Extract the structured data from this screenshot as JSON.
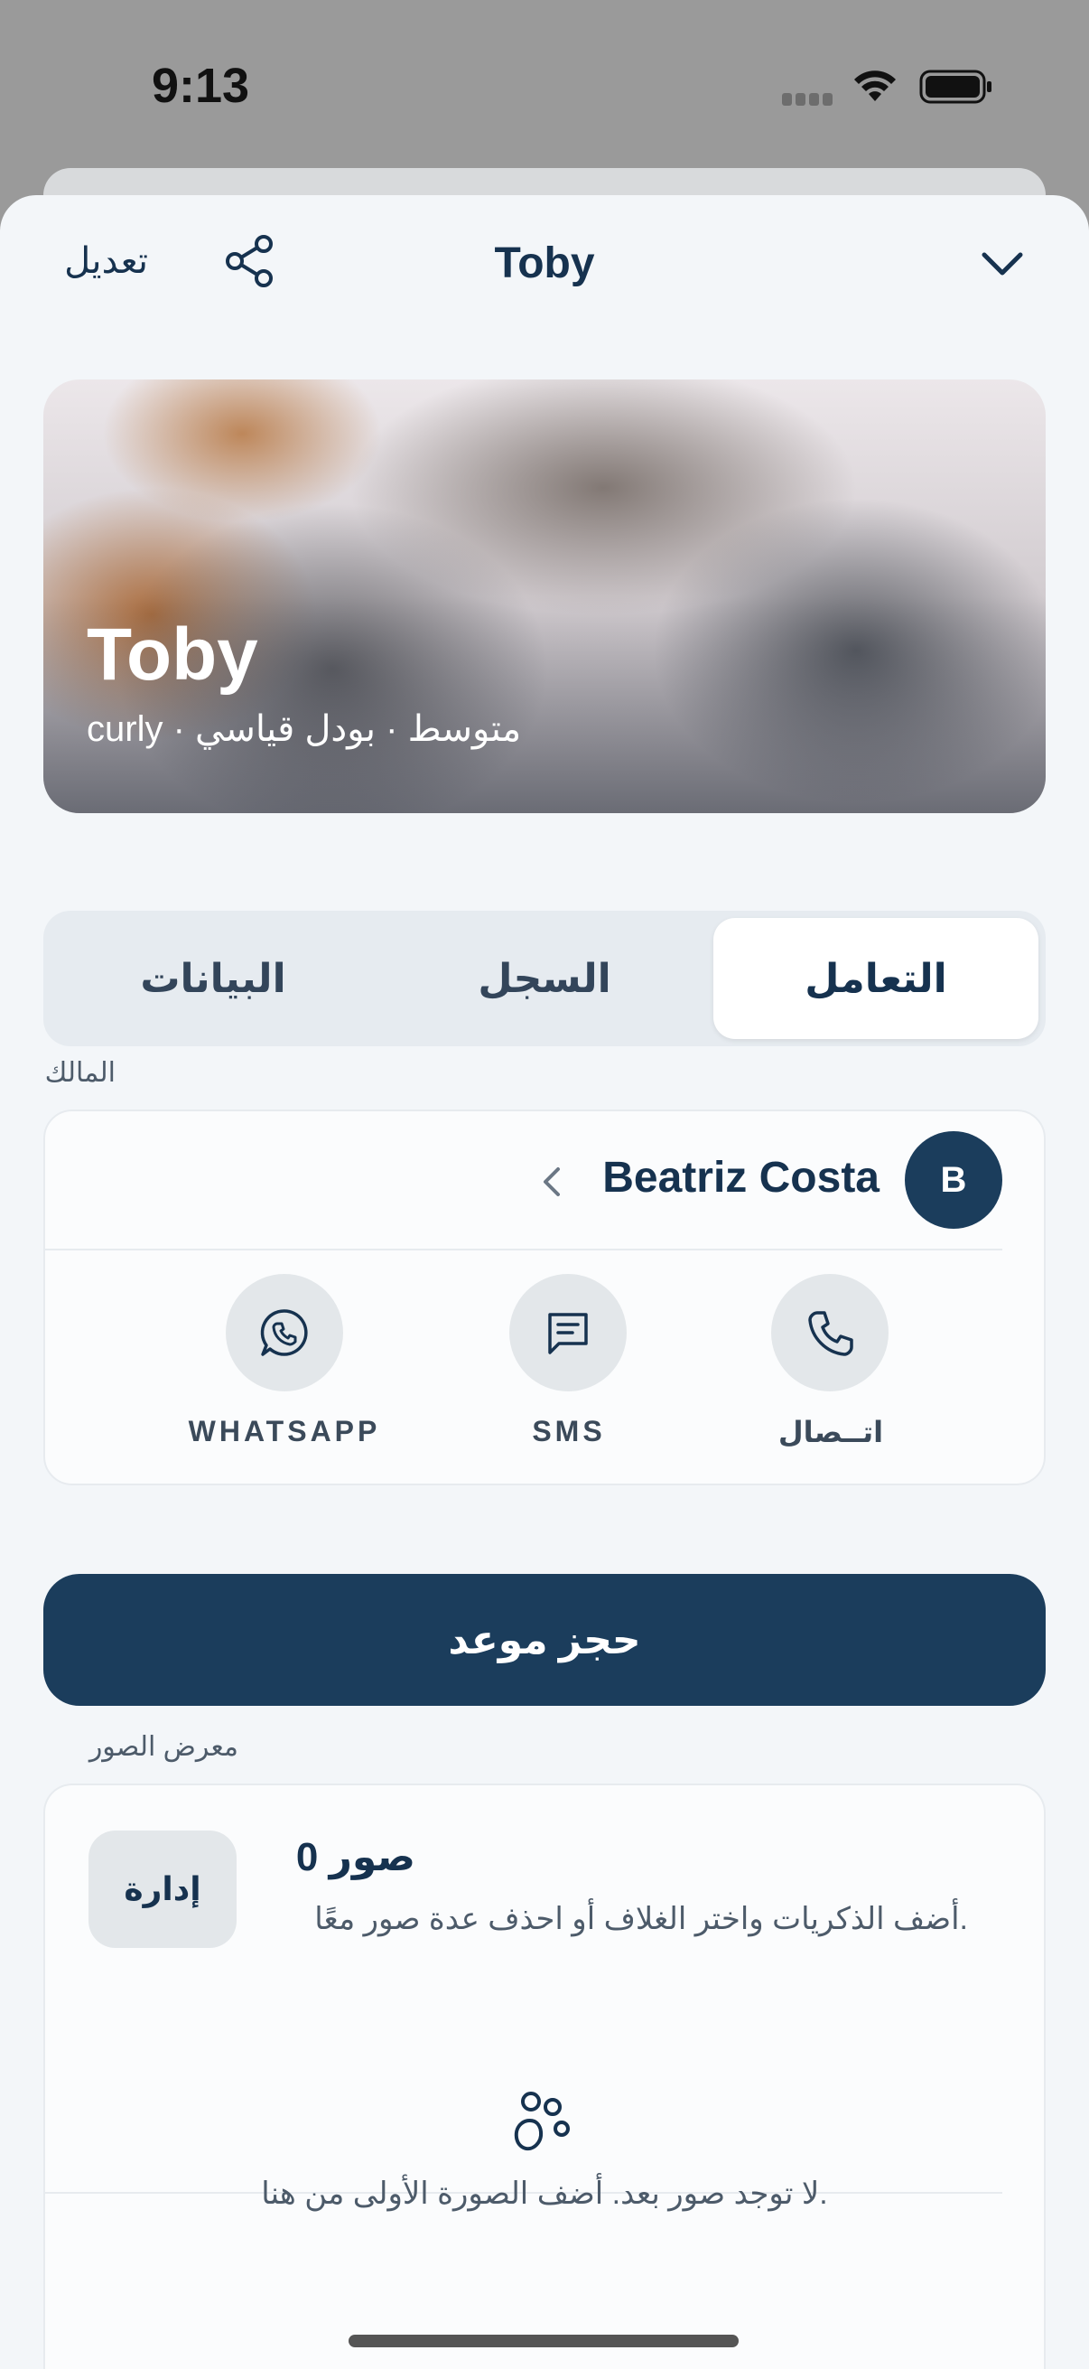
{
  "status_bar": {
    "time": "9:13"
  },
  "nav": {
    "edit_label": "تعديل",
    "title": "Toby"
  },
  "hero": {
    "name": "Toby",
    "subtitle": "curly · متوسط · بودل قياسي"
  },
  "tabs": [
    {
      "label": "التعامل",
      "active": true
    },
    {
      "label": "السجل",
      "active": false
    },
    {
      "label": "البيانات",
      "active": false
    }
  ],
  "owner": {
    "section_label": "المالك",
    "avatar_initial": "B",
    "name": "Beatriz Costa",
    "actions": [
      {
        "label": "اتــصال",
        "icon": "phone-icon"
      },
      {
        "label": "SMS",
        "icon": "message-icon"
      },
      {
        "label": "WHATSAPP",
        "icon": "whatsapp-icon"
      }
    ]
  },
  "book_button_label": "حجز موعد",
  "gallery": {
    "section_label": "معرض الصور",
    "count_label": "0 صور",
    "description": "أضف الذكريات واختر الغلاف أو احذف عدة صور معًا.",
    "manage_label": "إدارة",
    "empty_icon": "paw-icon",
    "empty_text": "لا توجد صور بعد. أضف الصورة الأولى من هنا."
  },
  "colors": {
    "primary": "#1b3d5c",
    "background": "#f3f6f9",
    "card": "#fbfcfd"
  }
}
